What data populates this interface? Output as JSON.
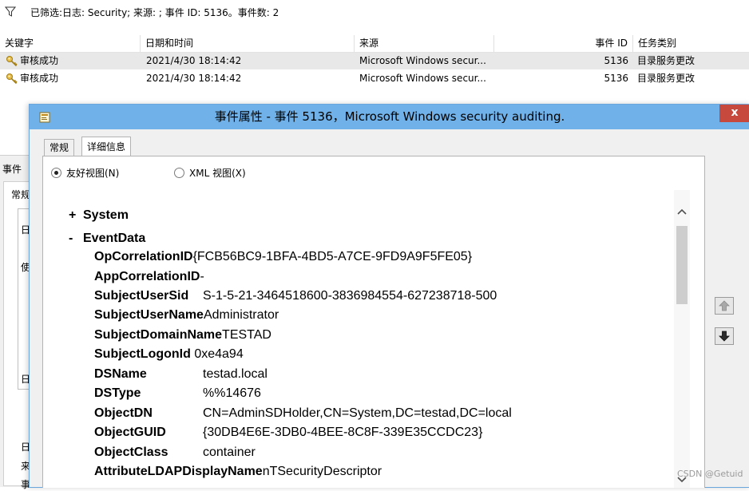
{
  "filter": {
    "text": "已筛选:日志: Security; 来源: ; 事件 ID: 5136。事件数: 2"
  },
  "grid": {
    "columns": [
      "关键字",
      "日期和时间",
      "来源",
      "事件 ID",
      "任务类别"
    ],
    "rows": [
      {
        "keyword": "审核成功",
        "datetime": "2021/4/30 18:14:42",
        "source": "Microsoft Windows secur...",
        "event_id": "5136",
        "task": "目录服务更改"
      },
      {
        "keyword": "审核成功",
        "datetime": "2021/4/30 18:14:42",
        "source": "Microsoft Windows secur...",
        "event_id": "5136",
        "task": "目录服务更改"
      }
    ]
  },
  "lower_pane": {
    "tab": "事件",
    "subtab": "常规",
    "labels": [
      "日",
      "使",
      "日",
      "日",
      "来",
      "事"
    ]
  },
  "dialog": {
    "title": "事件属性 - 事件 5136，Microsoft Windows security auditing.",
    "close_label": "x",
    "tabs": [
      "常规",
      "详细信息"
    ],
    "view_friendly": "友好视图(N)",
    "view_xml": "XML 视图(X)",
    "tree": {
      "system": {
        "sign": "+",
        "label": "System"
      },
      "eventdata": {
        "sign": "-",
        "label": "EventData"
      }
    },
    "fields": [
      {
        "name": "OpCorrelationID",
        "value": "{FCB56BC9-1BFA-4BD5-A7CE-9FD9A9F5FE05}"
      },
      {
        "name": "AppCorrelationID",
        "value": "-"
      },
      {
        "name": "SubjectUserSid",
        "value": "S-1-5-21-3464518600-3836984554-627238718-500"
      },
      {
        "name": "SubjectUserName",
        "value": "Administrator"
      },
      {
        "name": "SubjectDomainName",
        "value": "TESTAD"
      },
      {
        "name": "SubjectLogonId",
        "value": "0xe4a94"
      },
      {
        "name": "DSName",
        "value": "testad.local"
      },
      {
        "name": "DSType",
        "value": "%%14676"
      },
      {
        "name": "ObjectDN",
        "value": "CN=AdminSDHolder,CN=System,DC=testad,DC=local"
      },
      {
        "name": "ObjectGUID",
        "value": "{30DB4E6E-3DB0-4BEE-8C8F-339E35CCDC23}"
      },
      {
        "name": "ObjectClass",
        "value": "container"
      },
      {
        "name": "AttributeLDAPDisplayName",
        "value": "nTSecurityDescriptor"
      }
    ]
  },
  "watermark": "CSDN @Getuid",
  "colors": {
    "titlebar": "#6fb1e8",
    "close": "#c7493e",
    "selected_row": "#e8e8e8"
  }
}
